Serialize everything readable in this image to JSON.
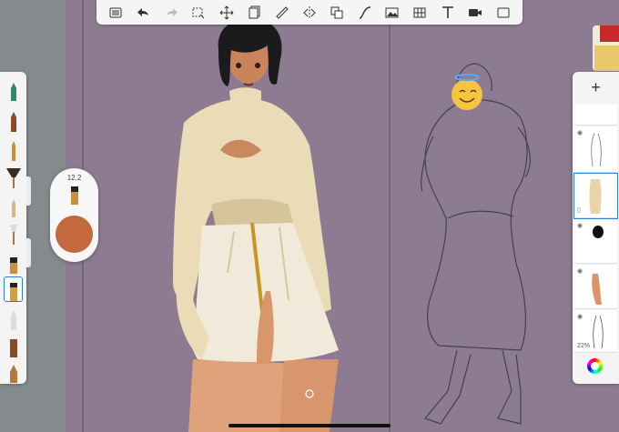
{
  "toolbar": {
    "tools": [
      "menu-icon",
      "undo-icon",
      "redo-icon",
      "selection-icon",
      "transform-icon",
      "layer-icon",
      "ruler-icon",
      "symmetry-icon",
      "fill-icon",
      "curve-icon",
      "image-icon",
      "perspective-icon",
      "text-icon",
      "video-icon",
      "fullscreen-icon"
    ]
  },
  "brush_puck": {
    "size_value": "12.2",
    "color": "#c4693d"
  },
  "brushes": [
    "pencil",
    "marker",
    "paintbrush",
    "fan-brush",
    "airbrush",
    "smudge",
    "eraser",
    "ink-pen",
    "dip-pen",
    "chisel",
    "wedge"
  ],
  "layers": {
    "add_label": "+",
    "opacity_label": "22%",
    "selected_index": 2
  },
  "colors": {
    "canvas": "#8c7b91",
    "accent": "#2a7fd4",
    "brush_color": "#c4693d"
  }
}
